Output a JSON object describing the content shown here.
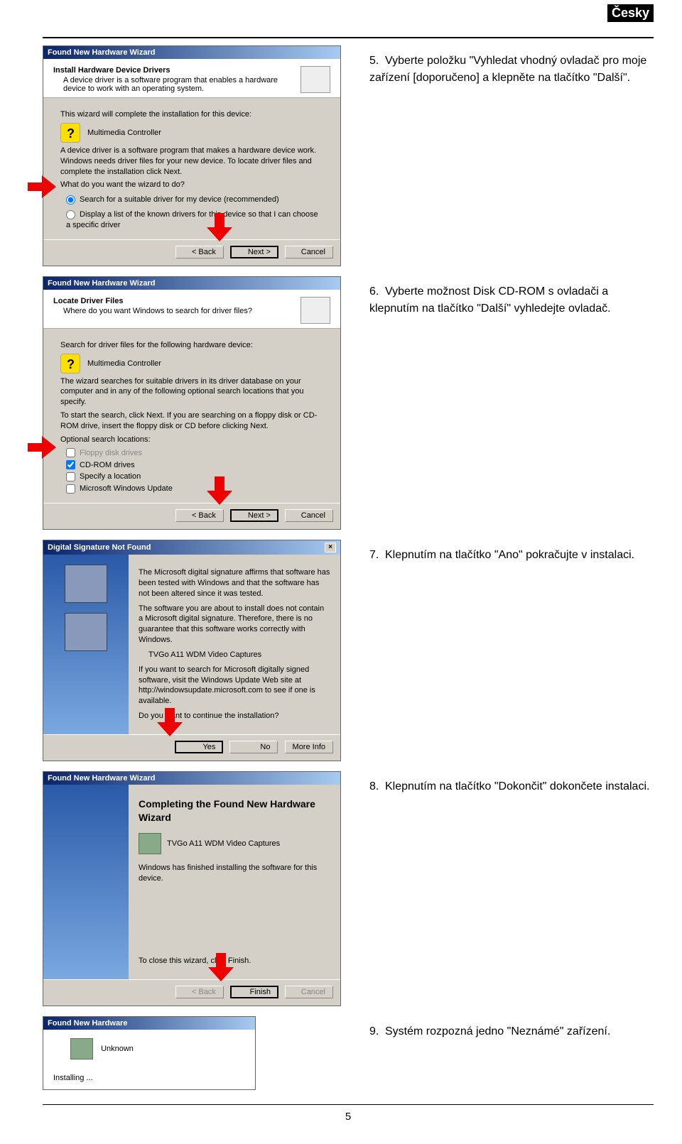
{
  "lang_badge": "Česky",
  "page_number": "5",
  "steps": [
    {
      "num": "5.",
      "text": "Vyberte položku \"Vyhledat vhodný ovladač pro moje zařízení [doporučeno] a klepněte na tlačítko \"Další\"."
    },
    {
      "num": "6.",
      "text": "Vyberte možnost Disk CD-ROM s ovladači a klepnutím na tlačítko \"Další\" vyhledejte ovladač."
    },
    {
      "num": "7.",
      "text": "Klepnutím na tlačítko \"Ano\" pokračujte v instalaci."
    },
    {
      "num": "8.",
      "text": "Klepnutím na tlačítko \"Dokončit\" dokončete instalaci."
    },
    {
      "num": "9.",
      "text": "Systém rozpozná jedno \"Neznámé\" zařízení."
    }
  ],
  "dlg1": {
    "title": "Found New Hardware Wizard",
    "heading": "Install Hardware Device Drivers",
    "sub": "A device driver is a software program that enables a hardware device to work with an operating system.",
    "intro": "This wizard will complete the installation for this device:",
    "device": "Multimedia Controller",
    "explain": "A device driver is a software program that makes a hardware device work. Windows needs driver files for your new device. To locate driver files and complete the installation click Next.",
    "prompt": "What do you want the wizard to do?",
    "opt1": "Search for a suitable driver for my device (recommended)",
    "opt2": "Display a list of the known drivers for this device so that I can choose a specific driver",
    "back": "< Back",
    "next": "Next >",
    "cancel": "Cancel"
  },
  "dlg2": {
    "title": "Found New Hardware Wizard",
    "heading": "Locate Driver Files",
    "sub": "Where do you want Windows to search for driver files?",
    "line1": "Search for driver files for the following hardware device:",
    "device": "Multimedia Controller",
    "line2": "The wizard searches for suitable drivers in its driver database on your computer and in any of the following optional search locations that you specify.",
    "line3": "To start the search, click Next. If you are searching on a floppy disk or CD-ROM drive, insert the floppy disk or CD before clicking Next.",
    "optlabel": "Optional search locations:",
    "c1": "Floppy disk drives",
    "c2": "CD-ROM drives",
    "c3": "Specify a location",
    "c4": "Microsoft Windows Update",
    "back": "< Back",
    "next": "Next >",
    "cancel": "Cancel"
  },
  "dlg3": {
    "title": "Digital Signature Not Found",
    "p1": "The Microsoft digital signature affirms that software has been tested with Windows and that the software has not been altered since it was tested.",
    "p2": "The software you are about to install does not contain a Microsoft digital signature. Therefore, there is no guarantee that this software works correctly with Windows.",
    "dev": "TVGo A11 WDM Video Captures",
    "p3": "If you want to search for Microsoft digitally signed software, visit the Windows Update Web site at http://windowsupdate.microsoft.com to see if one is available.",
    "q": "Do you want to continue the installation?",
    "yes": "Yes",
    "no": "No",
    "more": "More Info"
  },
  "dlg4": {
    "title": "Found New Hardware Wizard",
    "heading": "Completing the Found New Hardware Wizard",
    "dev": "TVGo A11 WDM Video Captures",
    "line1": "Windows has finished installing the software for this device.",
    "line2": "To close this wizard, click Finish.",
    "back": "< Back",
    "finish": "Finish",
    "cancel": "Cancel"
  },
  "dlg5": {
    "title": "Found New Hardware",
    "dev": "Unknown",
    "status": "Installing ..."
  }
}
